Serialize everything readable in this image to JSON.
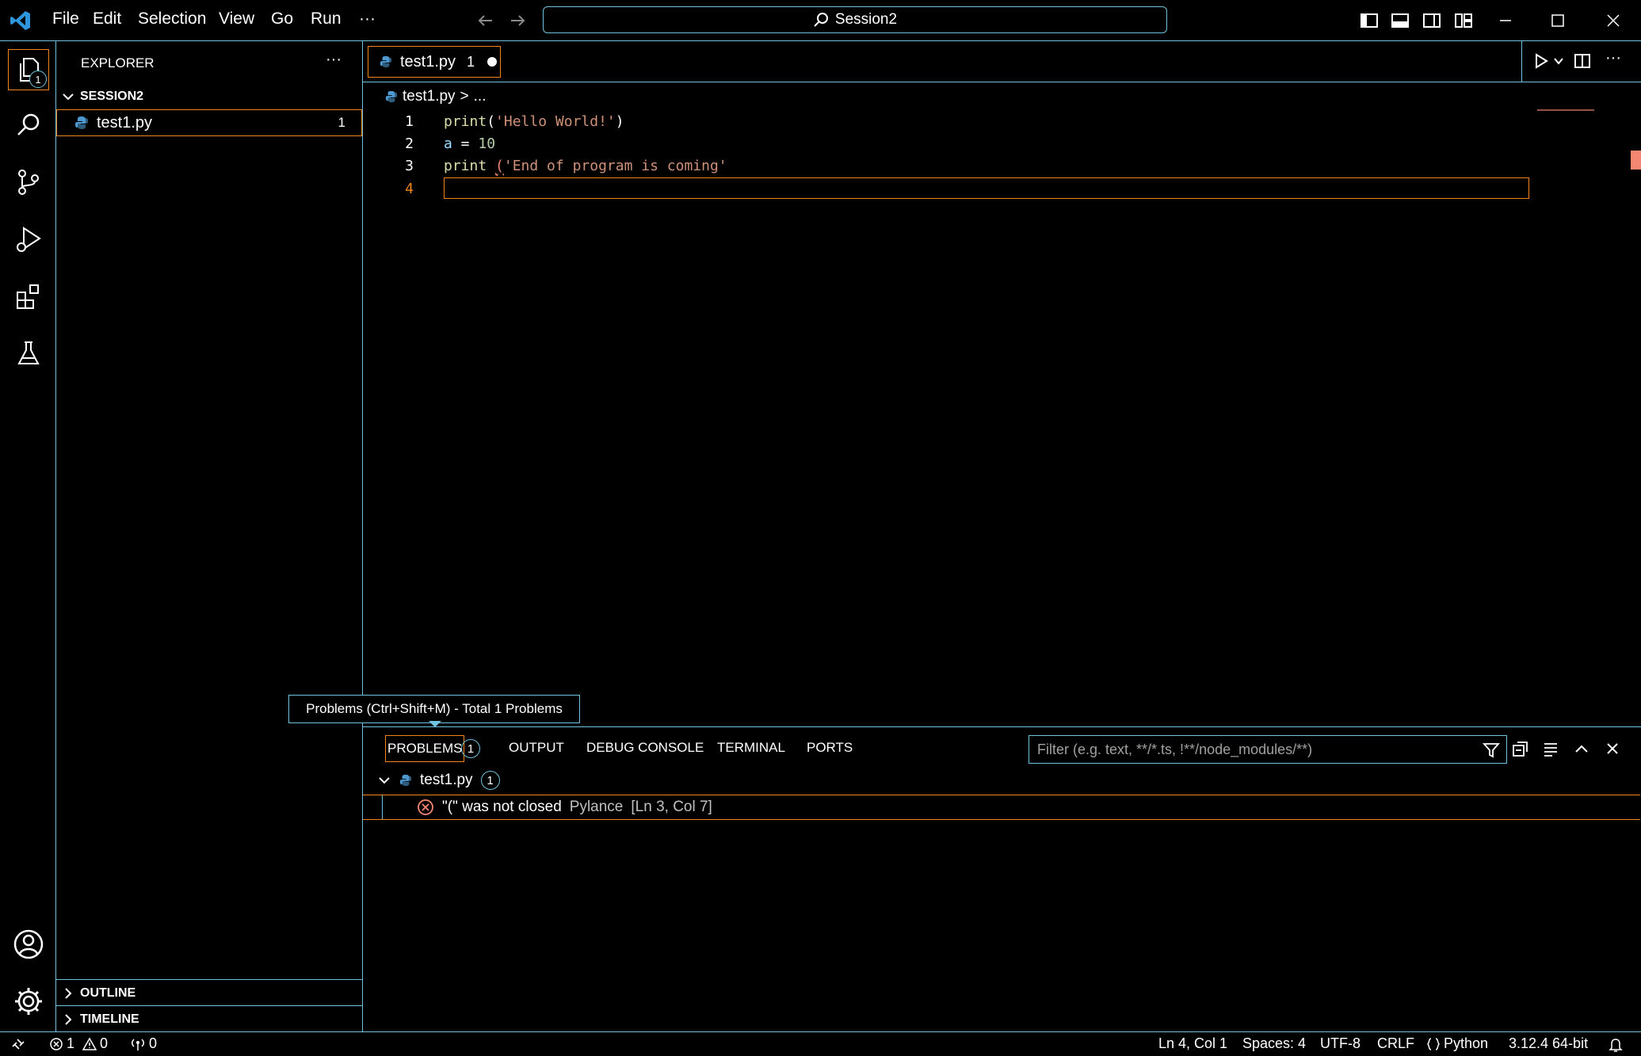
{
  "titlebar": {
    "menu": [
      "File",
      "Edit",
      "Selection",
      "View",
      "Go",
      "Run",
      "···"
    ],
    "command_center": "Session2",
    "icons": [
      "vscode-logo-icon",
      "back-arrow-icon",
      "forward-arrow-icon",
      "toggle-primary-sidebar-icon",
      "toggle-panel-icon",
      "toggle-secondary-sidebar-icon",
      "customize-layout-icon",
      "minimize-icon",
      "maximize-icon",
      "close-icon"
    ]
  },
  "activity_bar": {
    "explorer_badge": "1",
    "items": [
      "explorer-icon",
      "search-icon",
      "source-control-icon",
      "run-debug-icon",
      "extensions-icon",
      "testing-icon",
      "accounts-icon",
      "manage-gear-icon"
    ]
  },
  "sidebar": {
    "title": "EXPLORER",
    "more": "···",
    "folder": "SESSION2",
    "files": [
      {
        "name": "test1.py",
        "problems": "1"
      }
    ],
    "outline": "OUTLINE",
    "timeline": "TIMELINE"
  },
  "editor": {
    "tab": {
      "name": "test1.py",
      "problems": "1"
    },
    "breadcrumb": {
      "file": "test1.py",
      "sep": ">",
      "more": "..."
    },
    "lines": [
      {
        "num": "1",
        "parts": [
          [
            "fn",
            "print"
          ],
          [
            "punct",
            "("
          ],
          [
            "str",
            "'Hello World!'"
          ],
          [
            "punct",
            ")"
          ]
        ]
      },
      {
        "num": "2",
        "parts": [
          [
            "plain",
            "a"
          ],
          [
            "punct",
            " = "
          ],
          [
            "num",
            "10"
          ]
        ]
      },
      {
        "num": "3",
        "parts": [
          [
            "fn",
            "print"
          ],
          [
            "punct",
            " "
          ],
          [
            "err",
            "("
          ],
          [
            "str",
            "'End of program is coming'"
          ]
        ]
      },
      {
        "num": "4",
        "parts": []
      }
    ]
  },
  "panel": {
    "tooltip": "Problems (Ctrl+Shift+M) - Total 1 Problems",
    "tabs": [
      "PROBLEMS",
      "OUTPUT",
      "DEBUG CONSOLE",
      "TERMINAL",
      "PORTS"
    ],
    "problems_count": "1",
    "filter_placeholder": "Filter (e.g. text, **/*.ts, !**/node_modules/**)",
    "file": {
      "name": "test1.py",
      "count": "1"
    },
    "problem": {
      "message": "\"(\" was not closed",
      "source": "Pylance",
      "location": "[Ln 3, Col 7]"
    }
  },
  "statusbar": {
    "errors": "1",
    "warnings": "0",
    "ports": "0",
    "position": "Ln 4, Col 1",
    "spaces": "Spaces: 4",
    "encoding": "UTF-8",
    "eol": "CRLF",
    "language": "Python",
    "interpreter": "3.12.4 64-bit"
  },
  "colors": {
    "accent_border": "#6fc3df",
    "active_border": "#f38518",
    "error": "#f48771",
    "python_blue": "#4e9ad0"
  }
}
